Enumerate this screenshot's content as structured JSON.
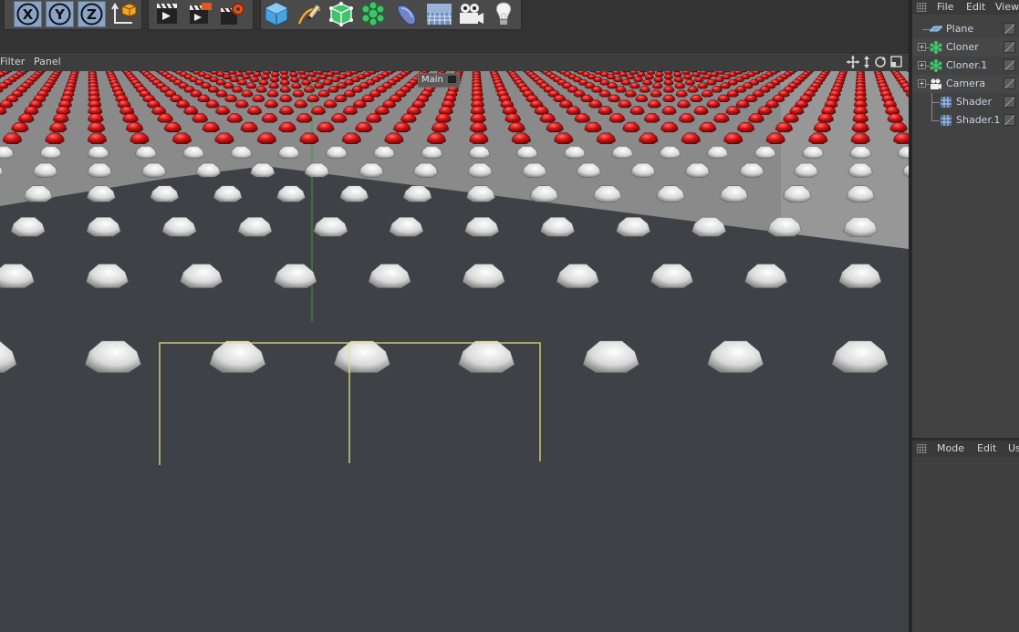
{
  "toolbar": {
    "x_label": "X",
    "y_label": "Y",
    "z_label": "Z",
    "icons": [
      "x-axis-lock-icon",
      "y-axis-lock-icon",
      "z-axis-lock-icon",
      "coordinate-system-icon",
      "render-view-icon",
      "render-picture-viewer-icon",
      "render-settings-icon",
      "cube-primitive-icon",
      "pen-spline-icon",
      "subdivision-surface-icon",
      "cloner-icon",
      "deformer-icon",
      "floor-plane-icon",
      "camera-icon",
      "light-icon"
    ]
  },
  "viewport": {
    "menu": [
      "Filter",
      "Panel"
    ],
    "view_label": "Main",
    "colors": {
      "background": "#8a8a8a",
      "floor": "#3e4247",
      "red_dome": "#d31212",
      "white_dome": "#d8d8d8",
      "selection": "#e8e07a",
      "y_axis": "#3a9a3a"
    }
  },
  "object_manager": {
    "menu": [
      "File",
      "Edit",
      "View"
    ],
    "objects": [
      {
        "label": "Plane",
        "icon": "plane-icon"
      },
      {
        "label": "Cloner",
        "icon": "cloner-icon"
      },
      {
        "label": "Cloner.1",
        "icon": "cloner-icon"
      },
      {
        "label": "Camera",
        "icon": "camera-icon"
      },
      {
        "label": "Shader",
        "icon": "shader-icon"
      },
      {
        "label": "Shader.1",
        "icon": "shader-icon"
      }
    ]
  },
  "attribute_manager": {
    "menu": [
      "Mode",
      "Edit",
      "Us"
    ]
  }
}
